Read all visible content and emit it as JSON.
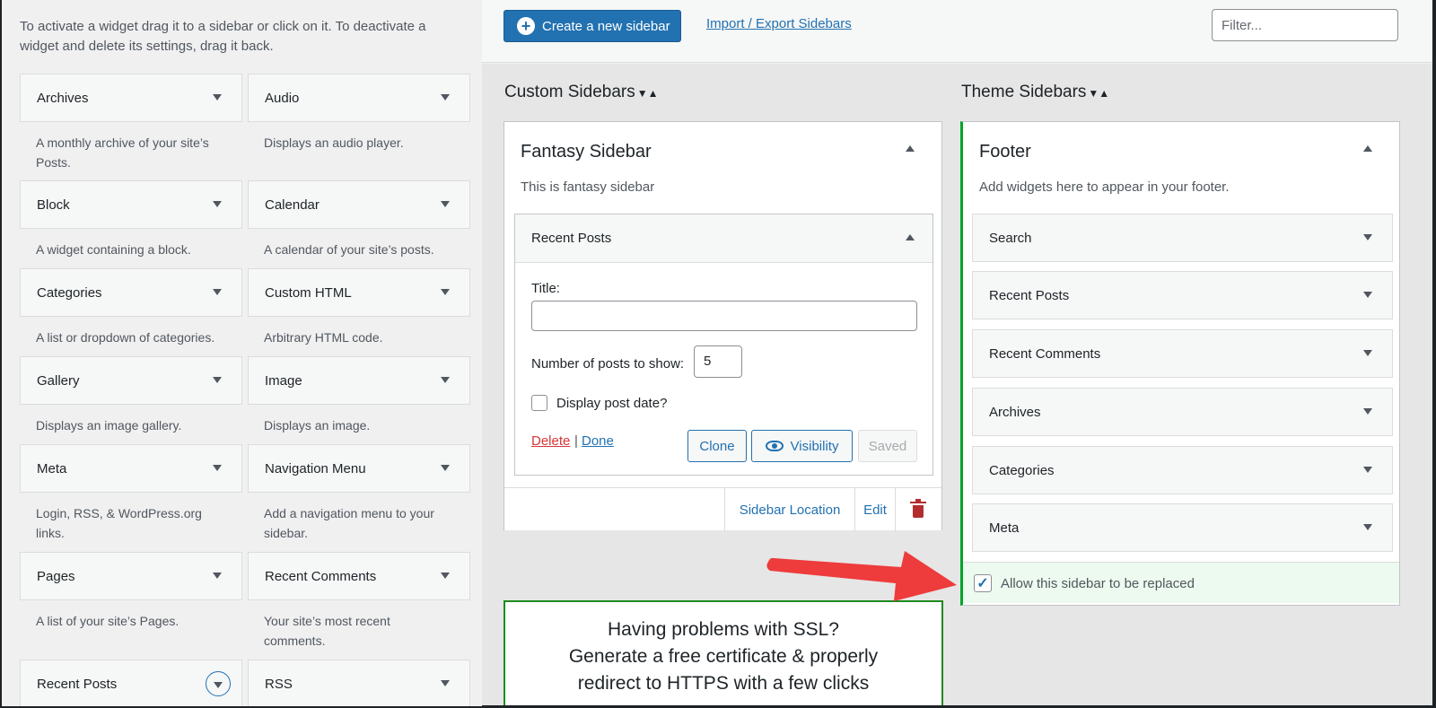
{
  "intro_text": "To activate a widget drag it to a sidebar or click on it. To deactivate a widget and delete its settings, drag it back.",
  "available_widgets": [
    {
      "name": "Archives",
      "desc": "A monthly archive of your site’s Posts."
    },
    {
      "name": "Audio",
      "desc": "Displays an audio player."
    },
    {
      "name": "Block",
      "desc": "A widget containing a block."
    },
    {
      "name": "Calendar",
      "desc": "A calendar of your site’s posts."
    },
    {
      "name": "Categories",
      "desc": "A list or dropdown of categories."
    },
    {
      "name": "Custom HTML",
      "desc": "Arbitrary HTML code."
    },
    {
      "name": "Gallery",
      "desc": "Displays an image gallery."
    },
    {
      "name": "Image",
      "desc": "Displays an image."
    },
    {
      "name": "Meta",
      "desc": "Login, RSS, & WordPress.org links."
    },
    {
      "name": "Navigation Menu",
      "desc": "Add a navigation menu to your sidebar."
    },
    {
      "name": "Pages",
      "desc": "A list of your site’s Pages."
    },
    {
      "name": "Recent Comments",
      "desc": "Your site’s most recent comments."
    },
    {
      "name": "Recent Posts",
      "desc": ""
    },
    {
      "name": "RSS",
      "desc": ""
    }
  ],
  "toolbar": {
    "create_label": "Create a new sidebar",
    "import_label": "Import / Export Sidebars",
    "filter_placeholder": "Filter..."
  },
  "custom_sidebars": {
    "heading": "Custom Sidebars",
    "sidebar": {
      "title": "Fantasy Sidebar",
      "desc": "This is fantasy sidebar",
      "widget": {
        "name": "Recent Posts",
        "title_label": "Title:",
        "title_value": "",
        "num_label": "Number of posts to show:",
        "num_value": "5",
        "date_label": "Display post date?",
        "delete_label": "Delete",
        "separator": "|",
        "done_label": "Done",
        "clone_label": "Clone",
        "visibility_label": "Visibility",
        "saved_label": "Saved"
      },
      "footer": {
        "location_label": "Sidebar Location",
        "edit_label": "Edit"
      }
    }
  },
  "theme_sidebars": {
    "heading": "Theme Sidebars",
    "sidebar": {
      "title": "Footer",
      "desc": "Add widgets here to appear in your footer.",
      "widgets": [
        "Search",
        "Recent Posts",
        "Recent Comments",
        "Archives",
        "Categories",
        "Meta"
      ],
      "allow_label": "Allow this sidebar to be replaced",
      "allow_checked": true
    }
  },
  "ssl_promo": {
    "line1": "Having problems with SSL?",
    "line2": "Generate a free certificate & properly",
    "line3": "redirect to HTTPS with a few clicks"
  },
  "colors": {
    "accent": "#2271b1",
    "danger": "#d63638",
    "success_border": "#1e8a1e",
    "arrow": "#ee3b3b"
  }
}
